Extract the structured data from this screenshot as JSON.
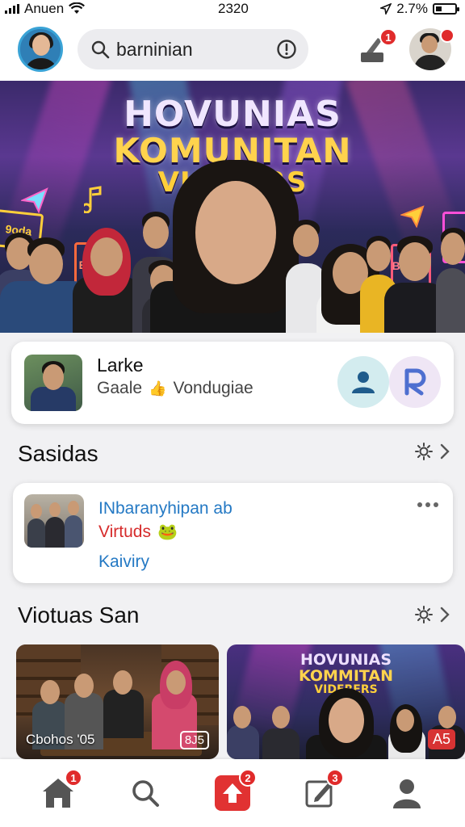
{
  "status_bar": {
    "carrier": "Anuen",
    "time": "2320",
    "battery": "2.7%",
    "battery_level_fraction": 0.3
  },
  "top_bar": {
    "search": {
      "value": "barninian"
    },
    "notifications_badge": "1"
  },
  "hero": {
    "title_lines": [
      "HOVUNIAS",
      "KOMUNITAN",
      "VICERIRS"
    ],
    "neon_signs": [
      "9oda",
      "Eaal",
      "Buhvie"
    ]
  },
  "featured_card": {
    "name": "Larke",
    "subtitle_left": "Gaale",
    "subtitle_icon": "👍",
    "subtitle_right": "Vondugiae"
  },
  "section1": {
    "title": "Sasidas",
    "card": {
      "line1": "INbaranyhipan ab",
      "line2": "Virtuds",
      "line2_icon": "🐸",
      "line3": "Kaiviry"
    }
  },
  "section2": {
    "title": "Viotuas San",
    "tiles": [
      {
        "caption": "Cbohos '05",
        "chip": "8J5"
      },
      {
        "title_lines": [
          "HOVUNIAS",
          "KOMMITAN",
          "VIDERERS"
        ],
        "chip": "A5"
      }
    ]
  },
  "bottom_nav": {
    "items": [
      {
        "name": "home",
        "badge": "1"
      },
      {
        "name": "search",
        "badge": ""
      },
      {
        "name": "upload",
        "badge": "2"
      },
      {
        "name": "compose",
        "badge": "3"
      },
      {
        "name": "profile",
        "badge": ""
      }
    ]
  },
  "colors": {
    "accent_red": "#e02b2b",
    "link_blue": "#2479c4",
    "avatar_ring": "#3aa3d6"
  }
}
